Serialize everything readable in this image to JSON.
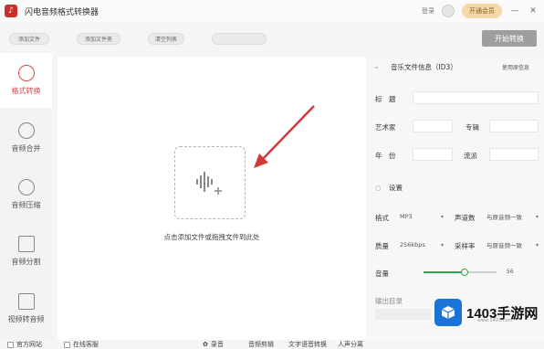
{
  "app": {
    "title": "闪电音频格式转换器",
    "logo_char": "♪"
  },
  "titlebar": {
    "login": "登录",
    "vip": "开通会员",
    "minimize": "—",
    "close": "✕"
  },
  "toolbar": {
    "add_file": "添加文件",
    "add_folder": "添加文件夹",
    "clear_list": "清空列表",
    "start": "开始转换"
  },
  "sidebar": {
    "items": [
      {
        "label": "格式转换",
        "icon": "convert-icon",
        "active": true
      },
      {
        "label": "音频合并",
        "icon": "merge-icon",
        "active": false
      },
      {
        "label": "音频压缩",
        "icon": "compress-icon",
        "active": false
      },
      {
        "label": "音频分割",
        "icon": "split-icon",
        "active": false
      },
      {
        "label": "视频转音频",
        "icon": "video-icon",
        "active": false
      }
    ]
  },
  "main": {
    "drop_text": "点击添加文件或拖拽文件到此处"
  },
  "panel": {
    "id3_title": "音乐文件信息（ID3）",
    "id3_link": "使用原信息",
    "fields": {
      "title": "标　题",
      "artist": "艺术家",
      "album": "专辑",
      "year": "年　份",
      "genre": "流派"
    },
    "settings_title": "设置",
    "format_label": "格式",
    "format_value": "MP3",
    "channel_label": "声道数",
    "channel_value": "与原音频一致",
    "quality_label": "质量",
    "quality_value": "256kbps",
    "sample_label": "采样率",
    "sample_value": "与原音频一致",
    "volume_label": "音量",
    "volume_value": "56",
    "output_label": "输出目录"
  },
  "bottom": {
    "website": "官方网站",
    "feedback": "在线客服",
    "record": "录音",
    "edit": "音频剪辑",
    "speech": "文字语音转换",
    "voice": "人声分离"
  },
  "watermark": {
    "brand": "1403手游网",
    "url": "www.1403.com"
  },
  "colors": {
    "accent": "#d94b4b",
    "slider": "#35a34a",
    "vip_bg": "#f3d9a8"
  }
}
